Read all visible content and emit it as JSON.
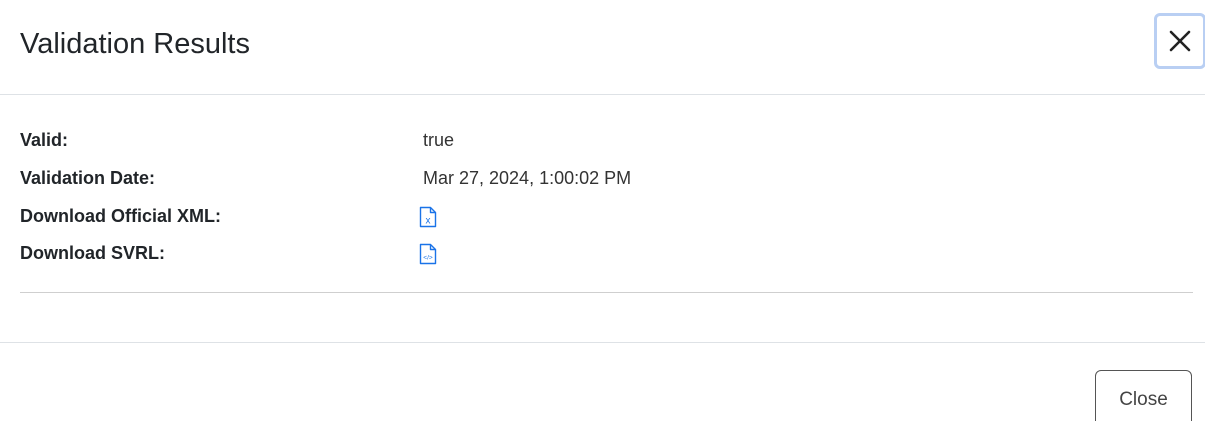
{
  "modal": {
    "title": "Validation Results",
    "close_icon": "close-x-icon"
  },
  "results": [
    {
      "label": "Valid:",
      "value": "true"
    },
    {
      "label": "Validation Date:",
      "value": "Mar 27, 2024, 1:00:02 PM"
    },
    {
      "label": "Download Official XML:",
      "icon": "xml-file-icon",
      "icon_glyph": "x"
    },
    {
      "label": "Download SVRL:",
      "icon": "code-file-icon",
      "icon_glyph": "</>"
    }
  ],
  "footer": {
    "close_label": "Close"
  },
  "colors": {
    "link_icon": "#1a73e8",
    "focus_ring": "#b9cff3",
    "divider": "#dee2e6"
  }
}
